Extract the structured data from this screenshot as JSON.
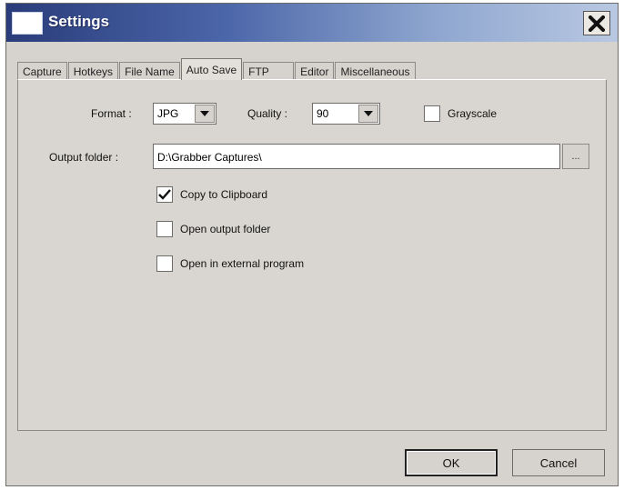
{
  "window": {
    "title": "Settings"
  },
  "tabs": [
    {
      "label": "Capture"
    },
    {
      "label": "Hotkeys"
    },
    {
      "label": "File Name"
    },
    {
      "label": "Auto Save"
    },
    {
      "label": "FTP"
    },
    {
      "label": "Editor"
    },
    {
      "label": "Miscellaneous"
    }
  ],
  "active_tab": "Auto Save",
  "auto_save": {
    "format_label": "Format :",
    "format_value": "JPG",
    "quality_label": "Quality :",
    "quality_value": "90",
    "grayscale_label": "Grayscale",
    "grayscale_checked": false,
    "output_folder_label": "Output folder :",
    "output_folder_value": "D:\\Grabber Captures\\",
    "browse_label": "...",
    "copy_clipboard_label": "Copy to Clipboard",
    "copy_clipboard_checked": true,
    "open_output_label": "Open output folder",
    "open_output_checked": false,
    "open_external_label": "Open in external program",
    "open_external_checked": false
  },
  "footer": {
    "ok_label": "OK",
    "cancel_label": "Cancel"
  }
}
